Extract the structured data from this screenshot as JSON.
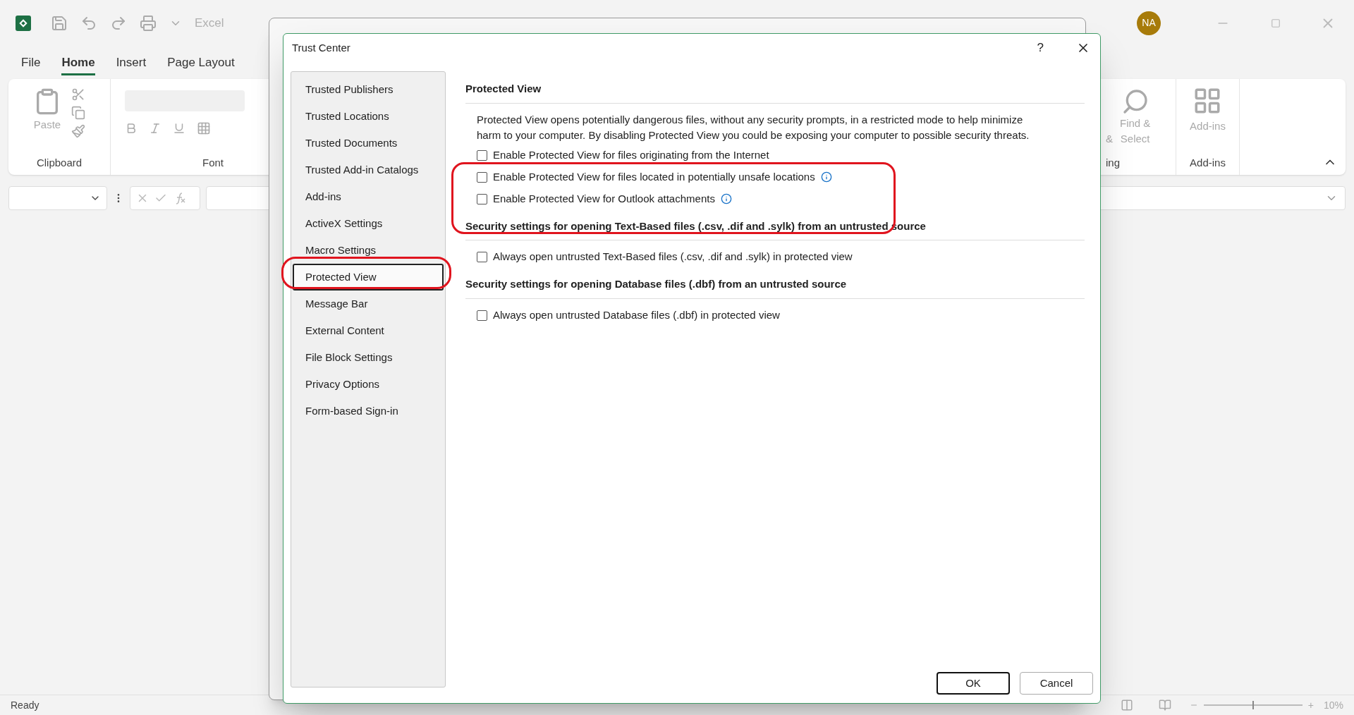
{
  "app": {
    "title": "Excel",
    "avatar": "NA",
    "tabs": [
      {
        "label": "File",
        "selected": false
      },
      {
        "label": "Home",
        "selected": true
      },
      {
        "label": "Insert",
        "selected": false
      },
      {
        "label": "Page Layout",
        "selected": false
      }
    ],
    "ribbon": {
      "paste": "Paste",
      "clipboard_label": "Clipboard",
      "font_label": "Font",
      "editing_partial": "&",
      "editing_label": "ing",
      "find": [
        "Find &",
        "Select"
      ],
      "addins_button": "Add-ins",
      "addins_label": "Add-ins"
    },
    "status_bar": {
      "text": "Ready",
      "zoom_in": "+",
      "level": 0.5,
      "zoom": "10%"
    }
  },
  "dialog": {
    "title": "Trust Center",
    "help": "?",
    "sidebar": [
      {
        "label": "Trusted Publishers",
        "selected": false
      },
      {
        "label": "Trusted Locations",
        "selected": false
      },
      {
        "label": "Trusted Documents",
        "selected": false
      },
      {
        "label": "Trusted Add-in Catalogs",
        "selected": false
      },
      {
        "label": "Add-ins",
        "selected": false
      },
      {
        "label": "ActiveX Settings",
        "selected": false
      },
      {
        "label": "Macro Settings",
        "selected": false
      },
      {
        "label": "Protected View",
        "selected": true
      },
      {
        "label": "Message Bar",
        "selected": false
      },
      {
        "label": "External Content",
        "selected": false
      },
      {
        "label": "File Block Settings",
        "selected": false
      },
      {
        "label": "Privacy Options",
        "selected": false
      },
      {
        "label": "Form-based Sign-in",
        "selected": false
      }
    ],
    "sections": [
      {
        "heading": "Protected View",
        "description": "Protected View opens potentially dangerous files, without any security prompts, in a restricted mode to help minimize harm to your computer. By disabling Protected View you could be exposing your computer to possible security threats.",
        "options": [
          {
            "label": "Enable Protected View for files originating from the Internet",
            "checked": false,
            "info": false
          },
          {
            "label": "Enable Protected View for files located in potentially unsafe locations",
            "checked": false,
            "info": true
          },
          {
            "label": "Enable Protected View for Outlook attachments",
            "checked": false,
            "info": true
          }
        ]
      },
      {
        "heading": "Security settings for opening Text-Based files (.csv, .dif and .sylk) from an untrusted source",
        "options": [
          {
            "label": "Always open untrusted Text-Based files (.csv, .dif and .sylk) in protected view",
            "checked": false,
            "info": false
          }
        ]
      },
      {
        "heading": "Security settings for opening Database files (.dbf) from an untrusted source",
        "options": [
          {
            "label": "Always open untrusted Database files (.dbf) in protected view",
            "checked": false,
            "info": false
          }
        ]
      }
    ],
    "buttons": [
      {
        "label": "OK",
        "default": true
      },
      {
        "label": "Cancel",
        "default": false
      }
    ]
  }
}
